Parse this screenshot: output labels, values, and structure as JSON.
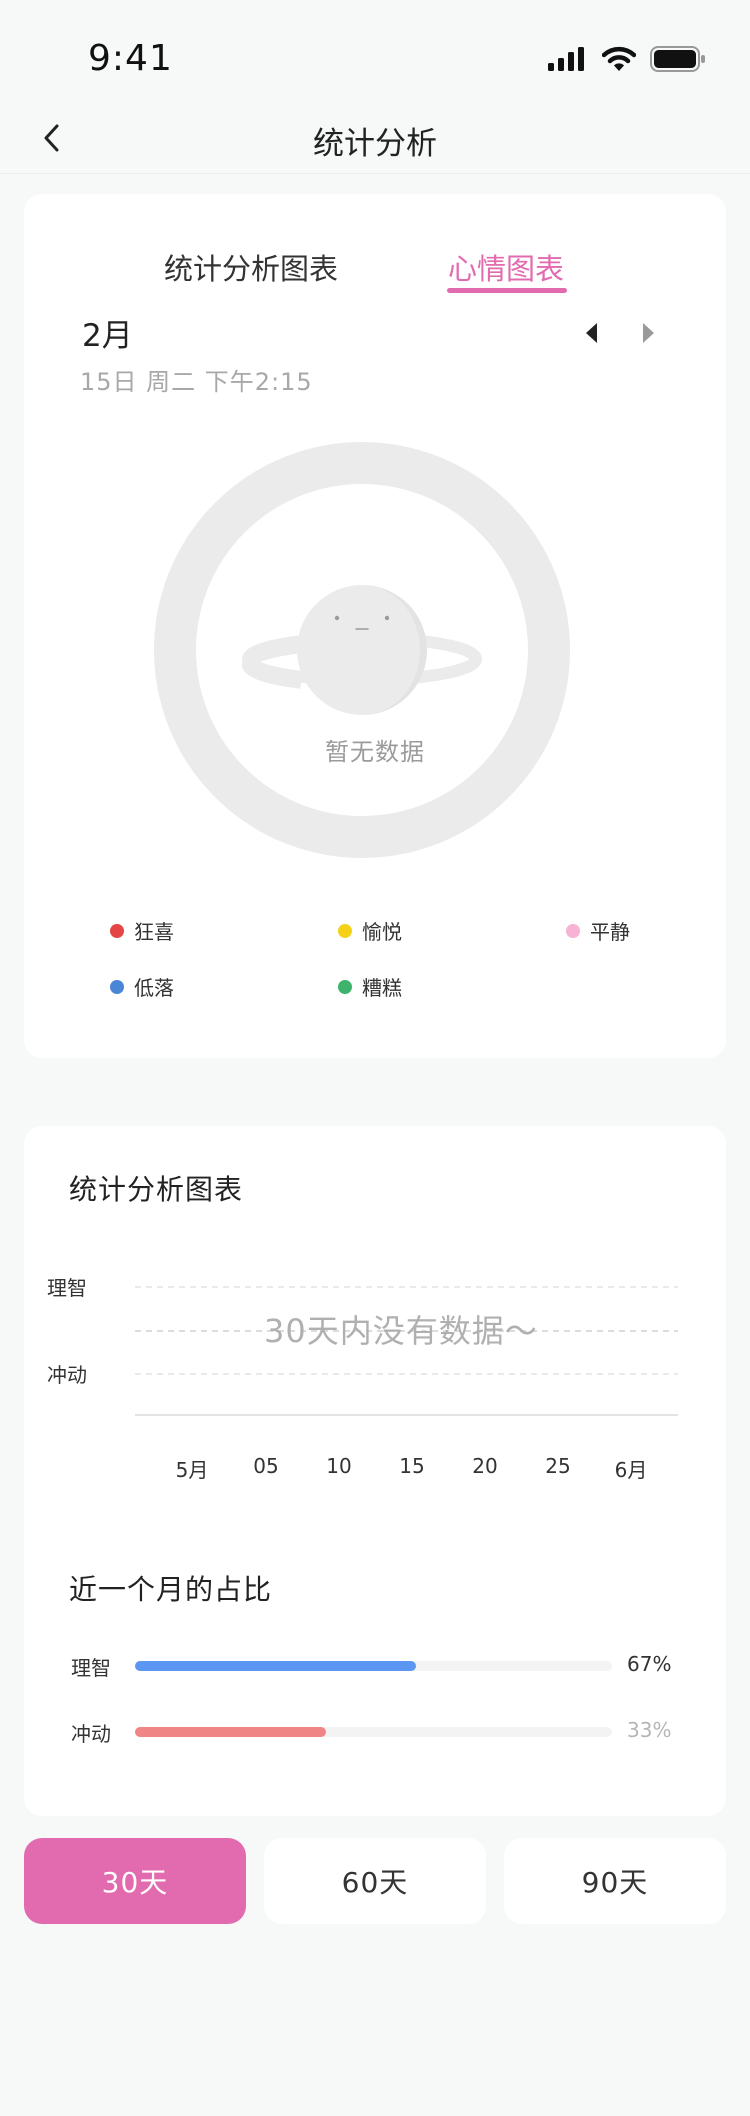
{
  "status_bar": {
    "time": "9:41",
    "icons": [
      "signal-icon",
      "wifi-icon",
      "battery-icon"
    ]
  },
  "nav": {
    "title": "统计分析",
    "back_icon": "chevron-left-icon"
  },
  "mood_card": {
    "tabs": [
      {
        "label": "统计分析图表",
        "active": false
      },
      {
        "label": "心情图表",
        "active": true
      }
    ],
    "month": "2月",
    "date": "15日 周二 下午2:15",
    "empty_text": "暂无数据",
    "legend": [
      {
        "label": "狂喜",
        "color": "#e64545"
      },
      {
        "label": "愉悦",
        "color": "#f5d218"
      },
      {
        "label": "平静",
        "color": "#f7b2d4"
      },
      {
        "label": "低落",
        "color": "#4a86d6"
      },
      {
        "label": "糟糕",
        "color": "#3db36b"
      }
    ]
  },
  "stats_card": {
    "title": "统计分析图表",
    "y_labels": [
      "理智",
      "冲动"
    ],
    "x_labels": [
      "5月",
      "05",
      "10",
      "15",
      "20",
      "25",
      "6月"
    ],
    "no_data_text": "30天内没有数据～",
    "ratio_title": "近一个月的占比",
    "bars": [
      {
        "label": "理智",
        "value": "67%",
        "fraction": 0.59,
        "color": "#5a96f2",
        "value_color": "#333333"
      },
      {
        "label": "冲动",
        "value": "33%",
        "fraction": 0.4,
        "color": "#f08585",
        "value_color": "#b5b5b5"
      }
    ]
  },
  "periods": [
    {
      "label": "30天",
      "active": true
    },
    {
      "label": "60天",
      "active": false
    },
    {
      "label": "90天",
      "active": false
    }
  ],
  "colors": {
    "accent": "#e26aae",
    "background": "#f7f8f8"
  }
}
